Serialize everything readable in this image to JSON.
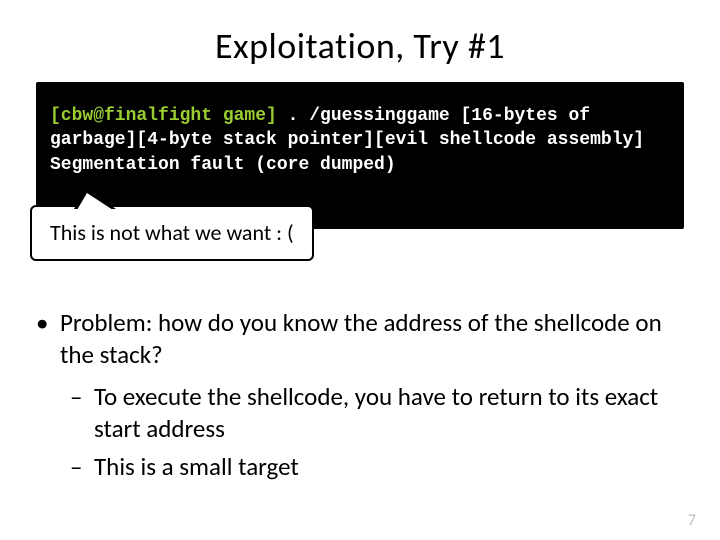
{
  "title": "Exploitation, Try #1",
  "terminal": {
    "prompt": "[cbw@finalfight game]",
    "cmd": ". /guessinggame [16-bytes of garbage][4-byte stack pointer][evil shellcode assembly]",
    "out": "Segmentation fault (core dumped)"
  },
  "callout": "This is not what we want : (",
  "bullets": {
    "b1": "Problem: how do you know the address of the shellcode on the stack?",
    "b2a": "To execute the shellcode, you have to return to its exact start address",
    "b2b": "This is a small target"
  },
  "page": "7"
}
